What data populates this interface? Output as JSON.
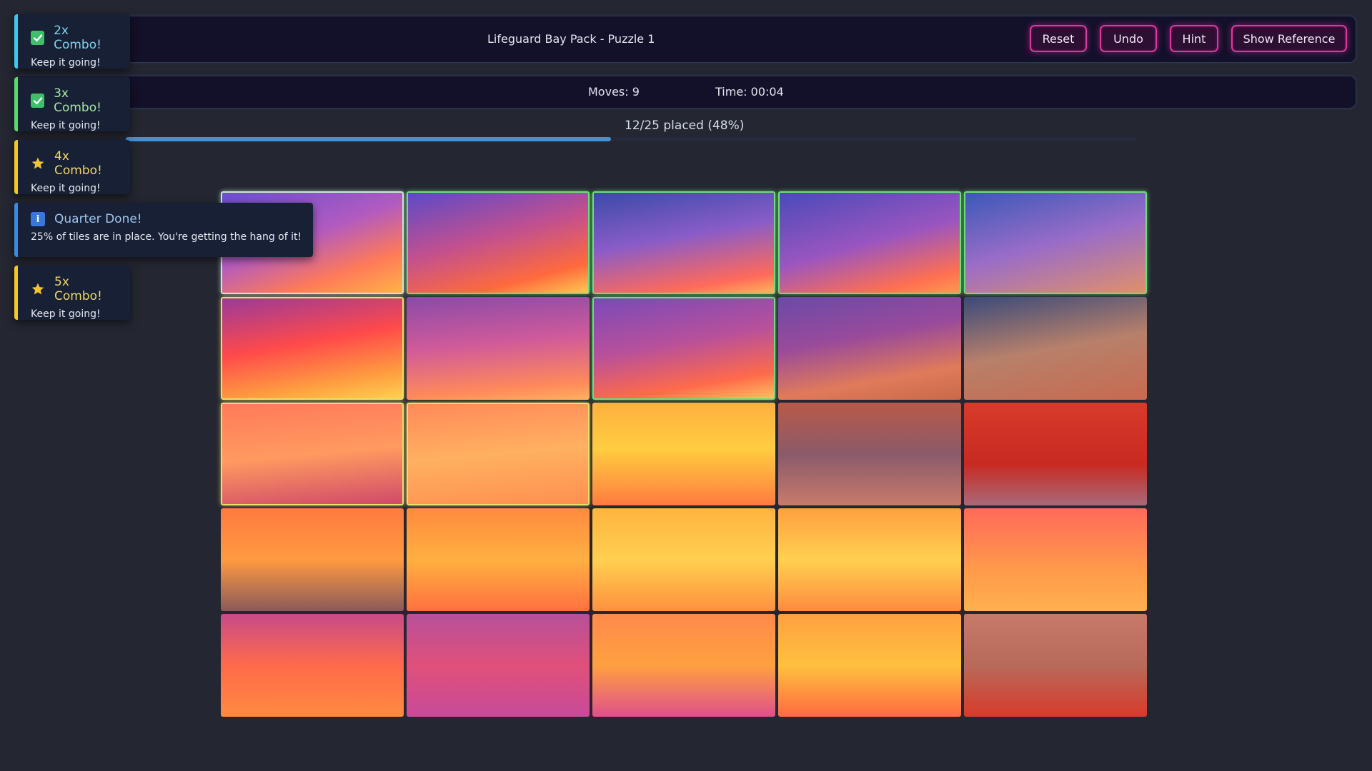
{
  "header": {
    "title": "Lifeguard Bay Pack - Puzzle 1",
    "buttons": {
      "reset": "Reset",
      "undo": "Undo",
      "hint": "Hint",
      "show_reference": "Show Reference"
    }
  },
  "stats": {
    "moves": "Moves: 9",
    "time": "Time: 00:04"
  },
  "progress": {
    "label": "12/25 placed (48%)",
    "fraction": 0.48
  },
  "board": {
    "rows": 5,
    "cols": 5,
    "placed_count": 12,
    "total_tiles": 25
  },
  "toasts": [
    {
      "title": "2x Combo!",
      "message": "Keep it going!",
      "icon": "check-icon",
      "accent": "#3cc8ec",
      "title_color": "#7fd4ee"
    },
    {
      "title": "3x Combo!",
      "message": "Keep it going!",
      "icon": "check-icon",
      "accent": "#58d96a",
      "title_color": "#a6e6a2"
    },
    {
      "title": "4x Combo!",
      "message": "Keep it going!",
      "icon": "star-icon",
      "accent": "#f0c828",
      "title_color": "#f0d670"
    },
    {
      "title": "Quarter Done!",
      "message": "25% of tiles are in place. You're getting the hang of it!",
      "icon": "info-icon",
      "accent": "#3a8ae0",
      "title_color": "#9fc4ee"
    },
    {
      "title": "5x Combo!",
      "message": "Keep it going!",
      "icon": "star-icon",
      "accent": "#f0c828",
      "title_color": "#f0d670"
    }
  ],
  "colors": {
    "button_border": "#e0359c",
    "placed_glow": "#6ddf7a",
    "progress_fill": "#4a90d0"
  }
}
